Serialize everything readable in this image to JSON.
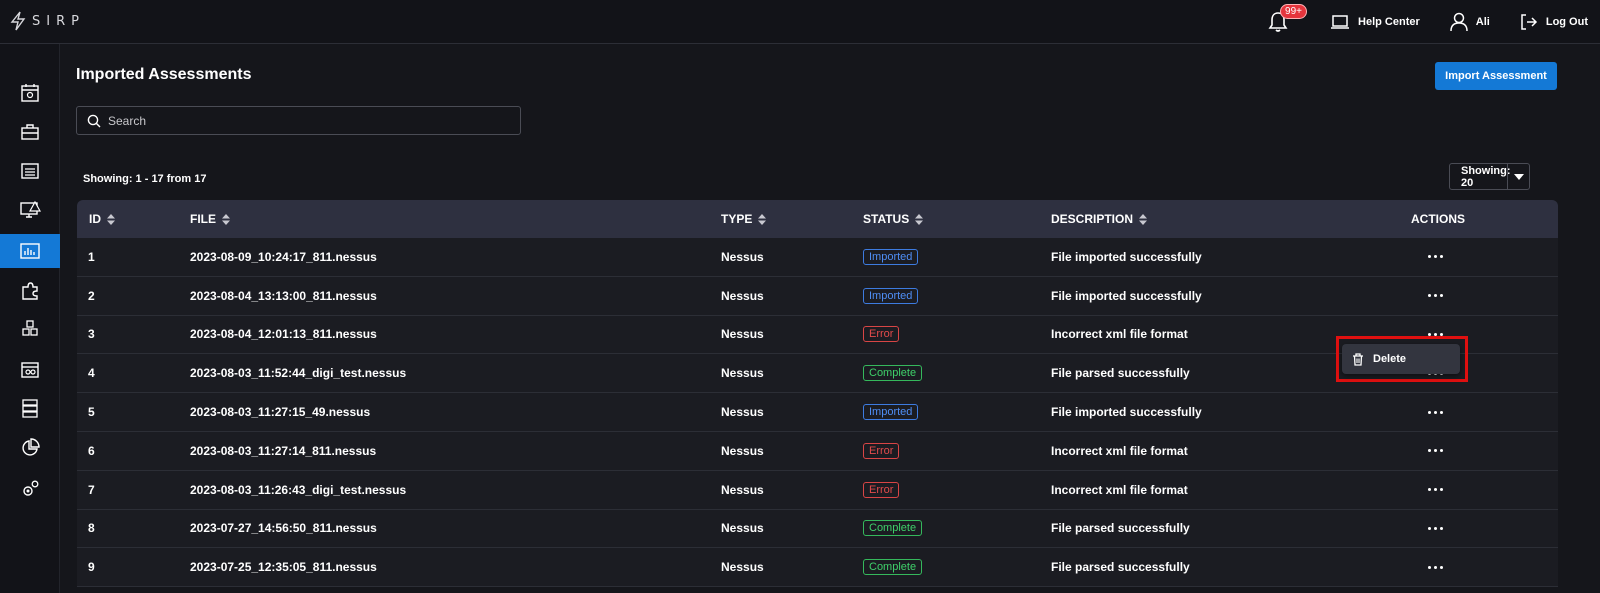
{
  "app": {
    "logo_text": "SIRP"
  },
  "topbar": {
    "notification_count": "99+",
    "help_center": "Help Center",
    "user_name": "Ali",
    "logout": "Log Out"
  },
  "sidebar": {
    "items": [
      {
        "icon": "calendar-dashboard-icon",
        "active": false
      },
      {
        "icon": "briefcase-icon",
        "active": false
      },
      {
        "icon": "list-icon",
        "active": false
      },
      {
        "icon": "monitor-alert-icon",
        "active": false
      },
      {
        "icon": "assessment-chart-icon",
        "active": true
      },
      {
        "icon": "puzzle-icon",
        "active": false
      },
      {
        "icon": "cubes-icon",
        "active": false
      },
      {
        "icon": "window-group-icon",
        "active": false
      },
      {
        "icon": "server-icon",
        "active": false
      },
      {
        "icon": "pie-chart-icon",
        "active": false
      },
      {
        "icon": "gears-icon",
        "active": false
      }
    ],
    "active_color": "#1479d6"
  },
  "page": {
    "title": "Imported Assessments",
    "import_button": "Import Assessment",
    "search_placeholder": "Search",
    "showing_text": "Showing: 1 - 17 from 17",
    "page_size_label": "Showing: 20"
  },
  "table": {
    "headers": {
      "id": "ID",
      "file": "FILE",
      "type": "TYPE",
      "status": "STATUS",
      "description": "DESCRIPTION",
      "actions": "ACTIONS"
    },
    "rows": [
      {
        "id": "1",
        "file": "2023-08-09_10:24:17_811.nessus",
        "type": "Nessus",
        "status": "Imported",
        "description": "File imported successfully"
      },
      {
        "id": "2",
        "file": "2023-08-04_13:13:00_811.nessus",
        "type": "Nessus",
        "status": "Imported",
        "description": "File imported successfully"
      },
      {
        "id": "3",
        "file": "2023-08-04_12:01:13_811.nessus",
        "type": "Nessus",
        "status": "Error",
        "description": "Incorrect xml file format"
      },
      {
        "id": "4",
        "file": "2023-08-03_11:52:44_digi_test.nessus",
        "type": "Nessus",
        "status": "Complete",
        "description": "File parsed successfully"
      },
      {
        "id": "5",
        "file": "2023-08-03_11:27:15_49.nessus",
        "type": "Nessus",
        "status": "Imported",
        "description": "File imported successfully"
      },
      {
        "id": "6",
        "file": "2023-08-03_11:27:14_811.nessus",
        "type": "Nessus",
        "status": "Error",
        "description": "Incorrect xml file format"
      },
      {
        "id": "7",
        "file": "2023-08-03_11:26:43_digi_test.nessus",
        "type": "Nessus",
        "status": "Error",
        "description": "Incorrect xml file format"
      },
      {
        "id": "8",
        "file": "2023-07-27_14:56:50_811.nessus",
        "type": "Nessus",
        "status": "Complete",
        "description": "File parsed successfully"
      },
      {
        "id": "9",
        "file": "2023-07-25_12:35:05_811.nessus",
        "type": "Nessus",
        "status": "Complete",
        "description": "File parsed successfully"
      }
    ]
  },
  "context_menu": {
    "delete_label": "Delete",
    "icon": "trash-icon"
  },
  "colors": {
    "accent": "#1479d6",
    "imported": "#4f8ef5",
    "error": "#e24b4b",
    "complete": "#3fd06a",
    "highlight": "#e01010"
  }
}
